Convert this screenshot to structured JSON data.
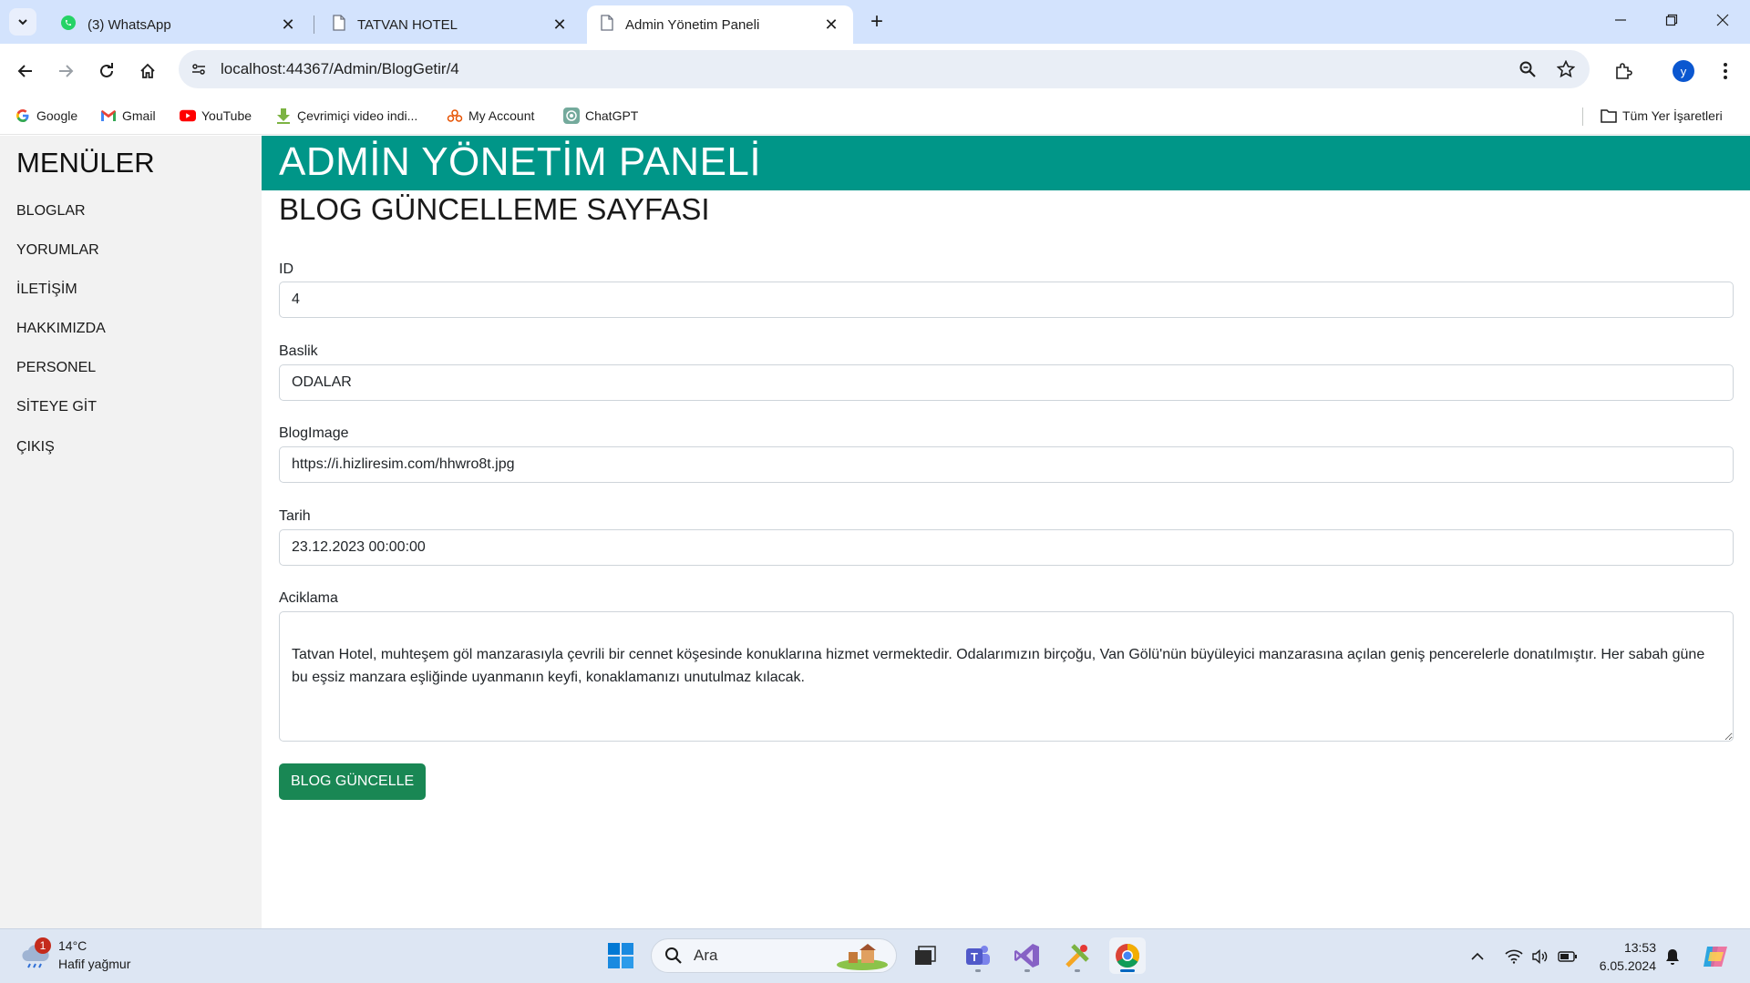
{
  "browser": {
    "tabs": [
      {
        "title": "(3) WhatsApp",
        "icon": "whatsapp-icon"
      },
      {
        "title": "TATVAN HOTEL",
        "icon": "page-icon"
      },
      {
        "title": "Admin Yönetim Paneli",
        "icon": "page-icon",
        "active": true
      }
    ],
    "url": "localhost:44367/Admin/BlogGetir/4",
    "profile_initial": "y",
    "bookmarks": [
      {
        "label": "Google",
        "icon": "google-icon"
      },
      {
        "label": "Gmail",
        "icon": "gmail-icon"
      },
      {
        "label": "YouTube",
        "icon": "youtube-icon"
      },
      {
        "label": "Çevrimiçi video indi...",
        "icon": "download-icon"
      },
      {
        "label": "My Account",
        "icon": "account-icon"
      },
      {
        "label": "ChatGPT",
        "icon": "chatgpt-icon"
      }
    ],
    "all_bookmarks_label": "Tüm Yer İşaretleri"
  },
  "sidebar": {
    "title": "MENÜLER",
    "items": [
      {
        "label": "BLOGLAR"
      },
      {
        "label": "YORUMLAR"
      },
      {
        "label": "İLETİŞİM"
      },
      {
        "label": "HAKKIMIZDA"
      },
      {
        "label": "PERSONEL"
      },
      {
        "label": "SİTEYE GİT"
      },
      {
        "label": "ÇIKIŞ"
      }
    ]
  },
  "header": {
    "title": "ADMİN YÖNETİM PANELİ"
  },
  "form": {
    "heading": "BLOG GÜNCELLEME SAYFASI",
    "fields": {
      "id": {
        "label": "ID",
        "value": "4"
      },
      "baslik": {
        "label": "Baslik",
        "value": "ODALAR"
      },
      "image": {
        "label": "BlogImage",
        "value": "https://i.hizliresim.com/hhwro8t.jpg"
      },
      "tarih": {
        "label": "Tarih",
        "value": "23.12.2023 00:00:00"
      },
      "aciklama": {
        "label": "Aciklama",
        "value": "Tatvan Hotel, muhteşem göl manzarasıyla çevrili bir cennet köşesinde konuklarına hizmet vermektedir. Odalarımızın birçoğu, Van Gölü'nün büyüleyici manzarasına açılan geniş pencerelerle donatılmıştır. Her sabah güne bu eşsiz manzara eşliğinde uyanmanın keyfi, konaklamanızı unutulmaz kılacak."
      }
    },
    "submit_label": "BLOG GÜNCELLE"
  },
  "colors": {
    "header_bg": "#009688",
    "button_bg": "#198754",
    "sidebar_bg": "#f2f2f2",
    "tabstrip_bg": "#d3e3fd"
  },
  "taskbar": {
    "weather": {
      "temp": "14°C",
      "desc": "Hafif yağmur",
      "badge": "1"
    },
    "search_placeholder": "Ara",
    "time": "13:53",
    "date": "6.05.2024"
  }
}
